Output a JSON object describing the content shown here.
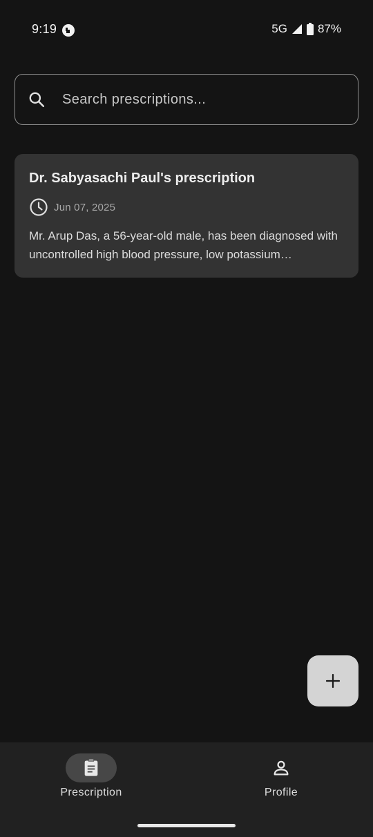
{
  "status_bar": {
    "time": "9:19",
    "network": "5G",
    "battery": "87%"
  },
  "search": {
    "placeholder": "Search prescriptions..."
  },
  "prescriptions": [
    {
      "title": "Dr. Sabyasachi Paul's prescription",
      "date": "Jun 07, 2025",
      "description": "Mr. Arup Das, a 56-year-old male, has been diagnosed with uncontrolled high blood pressure, low potassium…"
    }
  ],
  "fab": {
    "icon": "plus-icon"
  },
  "bottom_nav": {
    "items": [
      {
        "label": "Prescription",
        "icon": "clipboard-icon",
        "active": true
      },
      {
        "label": "Profile",
        "icon": "person-icon",
        "active": false
      }
    ]
  },
  "colors": {
    "background": "#141414",
    "card": "#333333",
    "fab": "#d4d4d4",
    "nav_bar": "#212121",
    "nav_active_pill": "#474747"
  }
}
